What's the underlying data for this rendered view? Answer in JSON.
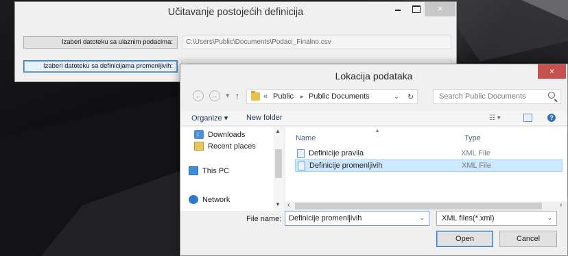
{
  "main_window": {
    "title": "Učitavanje postojećih definicija",
    "close_glyph": "×",
    "select_data_label": "Izaberi datoteku sa ulaznim podacima:",
    "data_path": "C:\\Users\\Public\\Documents\\Podaci_Finalno.csv",
    "select_defs_label": "Izaberi datoteku sa definicijama promenljivih:",
    "defs_path": ""
  },
  "dialog": {
    "title": "Lokacija podataka",
    "close_glyph": "×",
    "breadcrumb": {
      "prefix": "«",
      "parts": [
        "Public",
        "Public Documents"
      ]
    },
    "search_placeholder": "Search Public Documents",
    "toolbar": {
      "organize": "Organize ▾",
      "new_folder": "New folder"
    },
    "nav_items": [
      {
        "label": "Downloads",
        "icon": "downloads-icon"
      },
      {
        "label": "Recent places",
        "icon": "recent-places-icon"
      },
      {
        "label": "This PC",
        "icon": "this-pc-icon"
      },
      {
        "label": "Network",
        "icon": "network-icon"
      }
    ],
    "columns": {
      "name": "Name",
      "type": "Type"
    },
    "files": [
      {
        "name": "Definicije pravila",
        "type": "XML File",
        "selected": false
      },
      {
        "name": "Definicije promenljivih",
        "type": "XML File",
        "selected": true
      }
    ],
    "file_name_label": "File name:",
    "file_name_value": "Definicije promenljivih",
    "filter_value": "XML files(*.xml)",
    "open_label": "Open",
    "cancel_label": "Cancel"
  },
  "colors": {
    "selection": "#cde8ff",
    "close_red": "#c75050",
    "link_blue": "#1e395b"
  }
}
